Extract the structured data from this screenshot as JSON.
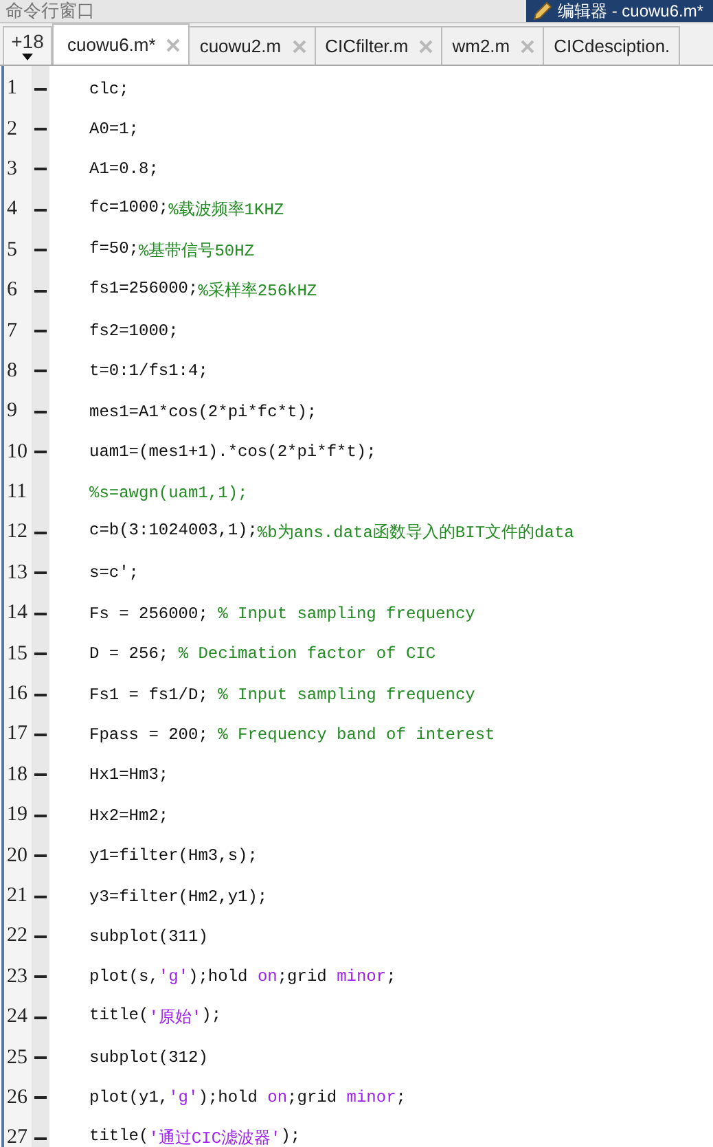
{
  "top_bar": {
    "panel_title": "命令行窗口",
    "editor_title": "编辑器 - cuowu6.m*"
  },
  "tabs_overflow": {
    "label": "+18"
  },
  "tabs": [
    {
      "label": "cuowu6.m*",
      "selected": true
    },
    {
      "label": "cuowu2.m",
      "selected": false
    },
    {
      "label": "CICfilter.m",
      "selected": false
    },
    {
      "label": "wm2.m",
      "selected": false
    },
    {
      "label": "CICdesciption.",
      "selected": false
    }
  ],
  "lines": [
    {
      "number": "1",
      "executable": true,
      "tokens": [
        {
          "kind": "code",
          "text": "clc;"
        }
      ]
    },
    {
      "number": "2",
      "executable": true,
      "tokens": [
        {
          "kind": "code",
          "text": "A0=1;"
        }
      ]
    },
    {
      "number": "3",
      "executable": true,
      "tokens": [
        {
          "kind": "code",
          "text": "A1=0.8;"
        }
      ]
    },
    {
      "number": "4",
      "executable": true,
      "tokens": [
        {
          "kind": "code",
          "text": "fc=1000;"
        },
        {
          "kind": "comment",
          "text": "%载波频率1KHZ"
        }
      ]
    },
    {
      "number": "5",
      "executable": true,
      "tokens": [
        {
          "kind": "code",
          "text": "f=50;"
        },
        {
          "kind": "comment",
          "text": "%基带信号50HZ"
        }
      ]
    },
    {
      "number": "6",
      "executable": true,
      "tokens": [
        {
          "kind": "code",
          "text": "fs1=256000;"
        },
        {
          "kind": "comment",
          "text": "%采样率256kHZ"
        }
      ]
    },
    {
      "number": "7",
      "executable": true,
      "tokens": [
        {
          "kind": "code",
          "text": "fs2=1000;"
        }
      ]
    },
    {
      "number": "8",
      "executable": true,
      "tokens": [
        {
          "kind": "code",
          "text": "t=0:1/fs1:4;"
        }
      ]
    },
    {
      "number": "9",
      "executable": true,
      "tokens": [
        {
          "kind": "code",
          "text": "mes1=A1*cos(2*pi*fc*t);"
        }
      ]
    },
    {
      "number": "10",
      "executable": true,
      "tokens": [
        {
          "kind": "code",
          "text": "uam1=(mes1+1).*cos(2*pi*f*t);"
        }
      ]
    },
    {
      "number": "11",
      "executable": false,
      "tokens": [
        {
          "kind": "comment",
          "text": "%s=awgn(uam1,1);"
        }
      ]
    },
    {
      "number": "12",
      "executable": true,
      "tokens": [
        {
          "kind": "code",
          "text": "c=b(3:1024003,1);"
        },
        {
          "kind": "comment",
          "text": "%b为ans.data函数导入的BIT文件的data"
        }
      ]
    },
    {
      "number": "13",
      "executable": true,
      "tokens": [
        {
          "kind": "code",
          "text": "s=c';"
        }
      ]
    },
    {
      "number": "14",
      "executable": true,
      "tokens": [
        {
          "kind": "code",
          "text": "Fs = 256000; "
        },
        {
          "kind": "comment",
          "text": "% Input sampling frequency"
        }
      ]
    },
    {
      "number": "15",
      "executable": true,
      "tokens": [
        {
          "kind": "code",
          "text": "D = 256; "
        },
        {
          "kind": "comment",
          "text": "% Decimation factor of CIC"
        }
      ]
    },
    {
      "number": "16",
      "executable": true,
      "tokens": [
        {
          "kind": "code",
          "text": "Fs1 = fs1/D; "
        },
        {
          "kind": "comment",
          "text": "% Input sampling frequency"
        }
      ]
    },
    {
      "number": "17",
      "executable": true,
      "tokens": [
        {
          "kind": "code",
          "text": "Fpass = 200; "
        },
        {
          "kind": "comment",
          "text": "% Frequency band of interest"
        }
      ]
    },
    {
      "number": "18",
      "executable": true,
      "tokens": [
        {
          "kind": "code",
          "text": "Hx1=Hm3;"
        }
      ]
    },
    {
      "number": "19",
      "executable": true,
      "tokens": [
        {
          "kind": "code",
          "text": "Hx2=Hm2;"
        }
      ]
    },
    {
      "number": "20",
      "executable": true,
      "tokens": [
        {
          "kind": "code",
          "text": "y1=filter(Hm3,s);"
        }
      ]
    },
    {
      "number": "21",
      "executable": true,
      "tokens": [
        {
          "kind": "code",
          "text": "y3=filter(Hm2,y1);"
        }
      ]
    },
    {
      "number": "22",
      "executable": true,
      "tokens": [
        {
          "kind": "code",
          "text": "subplot(311)"
        }
      ]
    },
    {
      "number": "23",
      "executable": true,
      "tokens": [
        {
          "kind": "code",
          "text": "plot(s,"
        },
        {
          "kind": "string",
          "text": "'g'"
        },
        {
          "kind": "code",
          "text": ");hold "
        },
        {
          "kind": "string",
          "text": "on"
        },
        {
          "kind": "code",
          "text": ";grid "
        },
        {
          "kind": "string",
          "text": "minor"
        },
        {
          "kind": "code",
          "text": ";"
        }
      ]
    },
    {
      "number": "24",
      "executable": true,
      "tokens": [
        {
          "kind": "code",
          "text": "title("
        },
        {
          "kind": "string",
          "text": "'原始'"
        },
        {
          "kind": "code",
          "text": ");"
        }
      ]
    },
    {
      "number": "25",
      "executable": true,
      "tokens": [
        {
          "kind": "code",
          "text": "subplot(312)"
        }
      ]
    },
    {
      "number": "26",
      "executable": true,
      "tokens": [
        {
          "kind": "code",
          "text": "plot(y1,"
        },
        {
          "kind": "string",
          "text": "'g'"
        },
        {
          "kind": "code",
          "text": ");hold "
        },
        {
          "kind": "string",
          "text": "on"
        },
        {
          "kind": "code",
          "text": ";grid "
        },
        {
          "kind": "string",
          "text": "minor"
        },
        {
          "kind": "code",
          "text": ";"
        }
      ]
    },
    {
      "number": "27",
      "executable": true,
      "tokens": [
        {
          "kind": "code",
          "text": "title("
        },
        {
          "kind": "string",
          "text": "'通过CIC滤波器'"
        },
        {
          "kind": "code",
          "text": ");"
        }
      ]
    }
  ]
}
